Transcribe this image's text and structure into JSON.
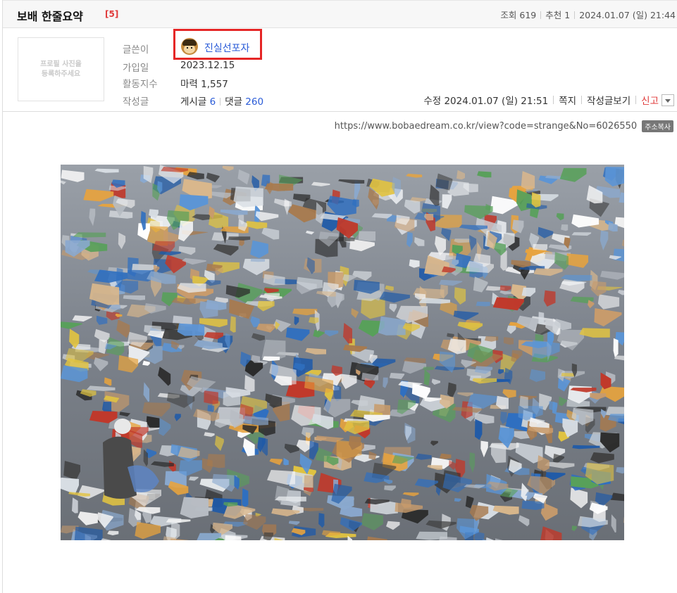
{
  "post": {
    "title": "보배 한줄요약",
    "reply_count": "[5]",
    "views_label": "조회 619",
    "recommend_label": "추천 1",
    "datetime": "2024.01.07 (일) 21:44"
  },
  "profile": {
    "photo_placeholder_line1": "프로필 사진을",
    "photo_placeholder_line2": "등록하주세요"
  },
  "author_info": {
    "author_label": "글쓴이",
    "author_name": "진실선포자",
    "join_label": "가입일",
    "join_date": "2023.12.15",
    "activity_label": "활동지수",
    "activity_value": "마력 1,557",
    "posts_label": "작성글",
    "posts_text": "게시글",
    "posts_count": "6",
    "comments_text": "댓글",
    "comments_count": "260"
  },
  "actions": {
    "edited": "수정 2024.01.07 (일) 21:51",
    "message": "쪽지",
    "view_posts": "작성글보기",
    "report": "신고"
  },
  "url": {
    "text": "https://www.bobaedream.co.kr/view?code=strange&No=6026550",
    "copy_label": "주소복사"
  },
  "colors": {
    "link_blue": "#2a5bd7",
    "red": "#e03a3a",
    "highlight": "#e52626"
  }
}
